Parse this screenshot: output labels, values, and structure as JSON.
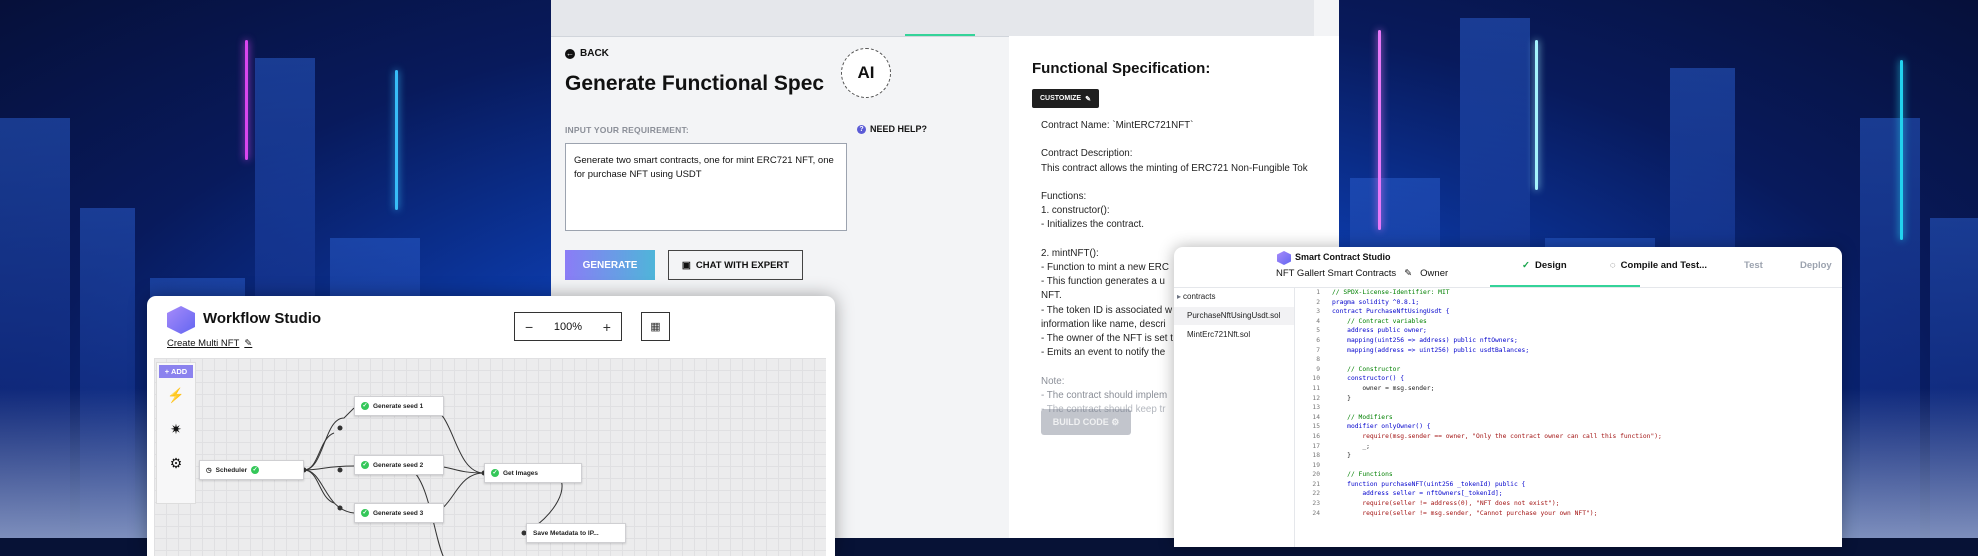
{
  "spec": {
    "back": "BACK",
    "title": "Generate Functional Spec",
    "ai_badge": "AI",
    "req_label": "INPUT YOUR REQUIREMENT:",
    "need_help": "NEED HELP?",
    "requirement": "Generate two smart contracts, one for mint ERC721 NFT, one for purchase NFT using USDT",
    "generate": "GENERATE",
    "chat": "CHAT WITH EXPERT",
    "fs_title": "Functional Specification:",
    "customize": "CUSTOMIZE",
    "lines": [
      {
        "text": "Contract Name: `MintERC721NFT`",
        "style": ""
      },
      {
        "text": "",
        "style": ""
      },
      {
        "text": "Contract Description:",
        "style": ""
      },
      {
        "text": "This contract allows the minting of ERC721 Non-Fungible Tok",
        "style": ""
      },
      {
        "text": "",
        "style": ""
      },
      {
        "text": "Functions:",
        "style": ""
      },
      {
        "text": "1. constructor():",
        "style": ""
      },
      {
        "text": "- Initializes the contract.",
        "style": ""
      },
      {
        "text": "",
        "style": ""
      },
      {
        "text": "2. mintNFT():",
        "style": ""
      },
      {
        "text": "- Function to mint a new ERC",
        "style": ""
      },
      {
        "text": "- This function generates a u",
        "style": ""
      },
      {
        "text": "NFT.",
        "style": ""
      },
      {
        "text": "- The token ID is associated w",
        "style": ""
      },
      {
        "text": "information like name, descri",
        "style": ""
      },
      {
        "text": "- The owner of the NFT is set t",
        "style": ""
      },
      {
        "text": "- Emits an event to notify the",
        "style": ""
      },
      {
        "text": "",
        "style": ""
      },
      {
        "text": "Note:",
        "style": "gray"
      },
      {
        "text": "- The contract should implem",
        "style": "gray"
      },
      {
        "text": "- The contract should keep tr",
        "style": "faded"
      }
    ],
    "build": "BUILD CODE"
  },
  "workflow": {
    "title": "Workflow Studio",
    "subtitle": "Create Multi NFT",
    "zoom": "100%",
    "add": "+ ADD",
    "nodes": [
      {
        "label": "Scheduler"
      },
      {
        "label": "Generate seed 1"
      },
      {
        "label": "Generate seed 2"
      },
      {
        "label": "Generate seed 3"
      },
      {
        "label": "Get Images"
      },
      {
        "label": "Save Metadata to IP..."
      }
    ]
  },
  "contract": {
    "title": "Smart Contract Studio",
    "project": "NFT Gallert Smart Contracts",
    "owner": "Owner",
    "steps": [
      "Design",
      "Compile and Test...",
      "Test",
      "Deploy"
    ],
    "files": [
      "contracts",
      "PurchaseNftUsingUsdt.sol",
      "MintErc721Nft.sol"
    ],
    "code": [
      {
        "n": "1",
        "cls": "c",
        "text": "// SPDX-License-Identifier: MIT"
      },
      {
        "n": "2",
        "cls": "k",
        "text": "pragma solidity ^0.8.1;"
      },
      {
        "n": "3",
        "cls": "k",
        "text": "contract PurchaseNftUsingUsdt {"
      },
      {
        "n": "4",
        "cls": "c",
        "text": "    // Contract variables"
      },
      {
        "n": "5",
        "cls": "k",
        "text": "    address public owner;"
      },
      {
        "n": "6",
        "cls": "k",
        "text": "    mapping(uint256 => address) public nftOwners;"
      },
      {
        "n": "7",
        "cls": "k",
        "text": "    mapping(address => uint256) public usdtBalances;"
      },
      {
        "n": "8",
        "cls": "t",
        "text": ""
      },
      {
        "n": "9",
        "cls": "c",
        "text": "    // Constructor"
      },
      {
        "n": "10",
        "cls": "k",
        "text": "    constructor() {"
      },
      {
        "n": "11",
        "cls": "t",
        "text": "        owner = msg.sender;"
      },
      {
        "n": "12",
        "cls": "t",
        "text": "    }"
      },
      {
        "n": "13",
        "cls": "t",
        "text": ""
      },
      {
        "n": "14",
        "cls": "c",
        "text": "    // Modifiers"
      },
      {
        "n": "15",
        "cls": "k",
        "text": "    modifier onlyOwner() {"
      },
      {
        "n": "16",
        "cls": "s",
        "text": "        require(msg.sender == owner, \"Only the contract owner can call this function\");"
      },
      {
        "n": "17",
        "cls": "t",
        "text": "        _;"
      },
      {
        "n": "18",
        "cls": "t",
        "text": "    }"
      },
      {
        "n": "19",
        "cls": "t",
        "text": ""
      },
      {
        "n": "20",
        "cls": "c",
        "text": "    // Functions"
      },
      {
        "n": "21",
        "cls": "k",
        "text": "    function purchaseNFT(uint256 _tokenId) public {"
      },
      {
        "n": "22",
        "cls": "k",
        "text": "        address seller = nftOwners[_tokenId];"
      },
      {
        "n": "23",
        "cls": "s",
        "text": "        require(seller != address(0), \"NFT does not exist\");"
      },
      {
        "n": "24",
        "cls": "s",
        "text": "        require(seller != msg.sender, \"Cannot purchase your own NFT\");"
      }
    ]
  }
}
